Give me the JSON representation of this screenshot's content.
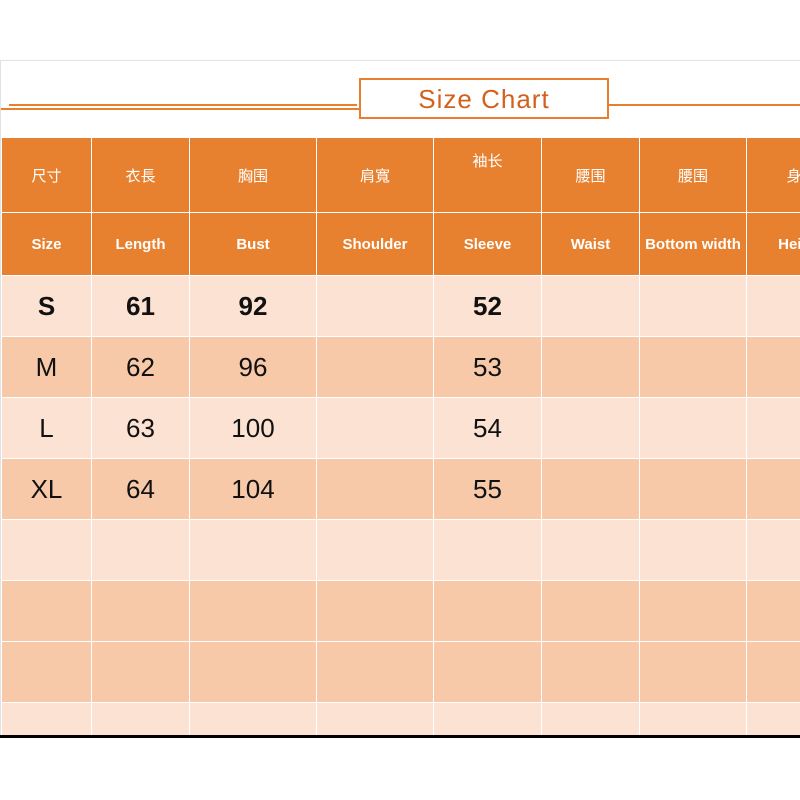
{
  "title": {
    "text": "Size Chart",
    "accent_color": "#D4601E",
    "border_color": "#E87E2E"
  },
  "colors": {
    "header_orange": "#E8812F",
    "row_light": "#FCE2D3",
    "row_dark": "#F7C9A8",
    "grid_line": "#FFFFFF",
    "bottom_rule": "#000000",
    "header_text": "#FFFFFF",
    "cell_text": "#111111"
  },
  "table": {
    "headers_cn": [
      "尺寸",
      "衣長",
      "胸围",
      "肩寬",
      "袖长",
      "腰围",
      "腰围",
      "身高"
    ],
    "headers_en": [
      "Size",
      "Length",
      "Bust",
      "Shoulder",
      "Sleeve",
      "Waist",
      "Bottom width",
      "Height"
    ],
    "rows": [
      {
        "shade": "light",
        "bold": true,
        "cells": [
          "S",
          "61",
          "92",
          "",
          "52",
          "",
          "",
          ""
        ]
      },
      {
        "shade": "dark",
        "bold": false,
        "cells": [
          "M",
          "62",
          "96",
          "",
          "53",
          "",
          "",
          ""
        ]
      },
      {
        "shade": "light",
        "bold": false,
        "cells": [
          "L",
          "63",
          "100",
          "",
          "54",
          "",
          "",
          ""
        ]
      },
      {
        "shade": "dark",
        "bold": false,
        "cells": [
          "XL",
          "64",
          "104",
          "",
          "55",
          "",
          "",
          ""
        ]
      },
      {
        "shade": "light",
        "bold": false,
        "cells": [
          "",
          "",
          "",
          "",
          "",
          "",
          "",
          ""
        ]
      },
      {
        "shade": "dark",
        "bold": false,
        "cells": [
          "",
          "",
          "",
          "",
          "",
          "",
          "",
          ""
        ]
      },
      {
        "shade": "dark",
        "bold": false,
        "cells": [
          "",
          "",
          "",
          "",
          "",
          "",
          "",
          ""
        ]
      },
      {
        "shade": "light",
        "bold": false,
        "cells": [
          "",
          "",
          "",
          "",
          "",
          "",
          "",
          ""
        ]
      }
    ]
  }
}
